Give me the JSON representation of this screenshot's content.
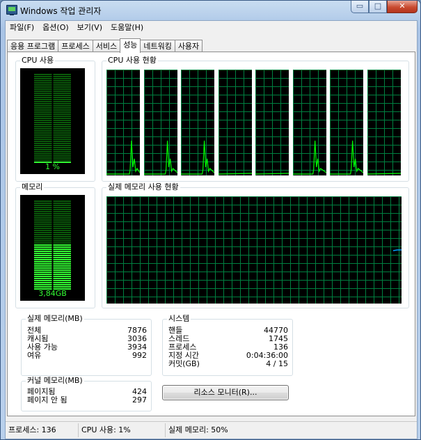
{
  "window": {
    "title": "Windows 작업 관리자",
    "minimize_glyph": "▭",
    "maximize_glyph": "□",
    "close_glyph": "✕"
  },
  "menu": [
    "파일(F)",
    "옵션(O)",
    "보기(V)",
    "도움말(H)"
  ],
  "tabs": [
    {
      "label": "응용 프로그램",
      "active": false
    },
    {
      "label": "프로세스",
      "active": false
    },
    {
      "label": "서비스",
      "active": false
    },
    {
      "label": "성능",
      "active": true
    },
    {
      "label": "네트워킹",
      "active": false
    },
    {
      "label": "사용자",
      "active": false
    }
  ],
  "cpu_usage": {
    "label": "CPU 사용",
    "value_text": "1 %",
    "percent": 1
  },
  "cpu_history": {
    "label": "CPU 사용 현황",
    "cores": 8
  },
  "memory": {
    "label": "메모리",
    "value_text": "3,84GB",
    "percent": 50
  },
  "memory_history": {
    "label": "실제 메모리 사용 현황"
  },
  "physical_memory": {
    "label": "실제 메모리(MB)",
    "rows": [
      {
        "label": "전체",
        "value": "7876"
      },
      {
        "label": "캐시됨",
        "value": "3036"
      },
      {
        "label": "사용 가능",
        "value": "3934"
      },
      {
        "label": "여유",
        "value": "992"
      }
    ]
  },
  "kernel_memory": {
    "label": "커널 메모리(MB)",
    "rows": [
      {
        "label": "페이지됨",
        "value": "424"
      },
      {
        "label": "페이지 안 됨",
        "value": "297"
      }
    ]
  },
  "system": {
    "label": "시스템",
    "rows": [
      {
        "label": "핸들",
        "value": "44770"
      },
      {
        "label": "스레드",
        "value": "1745"
      },
      {
        "label": "프로세스",
        "value": "136"
      },
      {
        "label": "지정 시간",
        "value": "0:04:36:00"
      },
      {
        "label": "커밋(GB)",
        "value": "4 / 15"
      }
    ]
  },
  "resource_monitor_button": "리소스 모니터(R)...",
  "status": {
    "processes": "프로세스: 136",
    "cpu": "CPU 사용: 1%",
    "memory": "실제 메모리: 50%"
  },
  "colors": {
    "graph_line": "#00ff00",
    "graph_grid": "#008040",
    "memory_line": "#00a0ff",
    "meter_on": "#33ff33",
    "meter_off": "#0a5a0a"
  }
}
